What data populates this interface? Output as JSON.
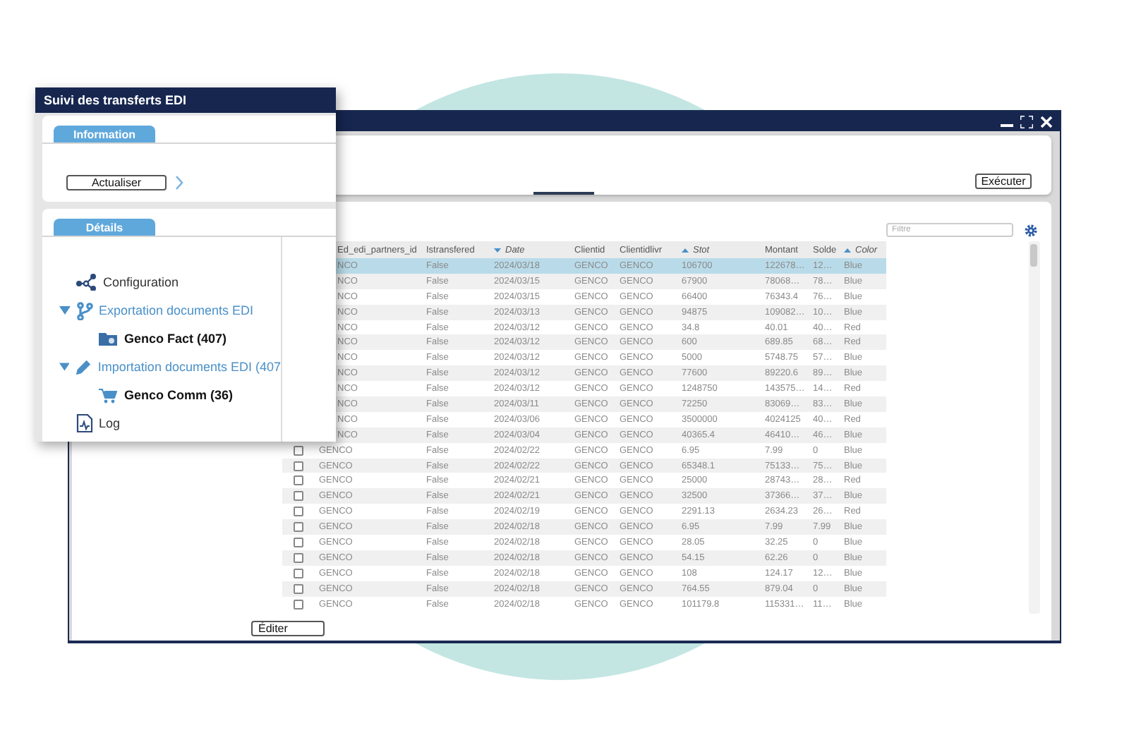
{
  "back_window": {
    "execute_button": "Exécuter",
    "filter": {
      "placeholder": "Filtre"
    },
    "table": {
      "columns": [
        {
          "label": "Ed_edi_partners_id"
        },
        {
          "label": "Istransfered"
        },
        {
          "label": "Date",
          "sort_ascending": false
        },
        {
          "label": "Clientid"
        },
        {
          "label": "Clientidlivr"
        },
        {
          "label": "Stot",
          "sort_ascending": true
        },
        {
          "label": "Montant"
        },
        {
          "label": "Solde"
        },
        {
          "label": "Color",
          "sort_ascending": true
        }
      ],
      "rows": [
        {
          "selected": true,
          "cells": [
            "NCO",
            "False",
            "2024/03/18",
            "GENCO",
            "GENCO",
            "106700",
            "122678…",
            "12…",
            "Blue"
          ]
        },
        {
          "selected": false,
          "cells": [
            "NCO",
            "False",
            "2024/03/15",
            "GENCO",
            "GENCO",
            "67900",
            "78068…",
            "78…",
            "Blue"
          ]
        },
        {
          "selected": false,
          "cells": [
            "NCO",
            "False",
            "2024/03/15",
            "GENCO",
            "GENCO",
            "66400",
            "76343.4",
            "76…",
            "Blue"
          ]
        },
        {
          "selected": false,
          "cells": [
            "NCO",
            "False",
            "2024/03/13",
            "GENCO",
            "GENCO",
            "94875",
            "109082…",
            "10…",
            "Blue"
          ]
        },
        {
          "selected": false,
          "cells": [
            "NCO",
            "False",
            "2024/03/12",
            "GENCO",
            "GENCO",
            "34.8",
            "40.01",
            "40…",
            "Red"
          ]
        },
        {
          "selected": false,
          "cells": [
            "NCO",
            "False",
            "2024/03/12",
            "GENCO",
            "GENCO",
            "600",
            "689.85",
            "68…",
            "Red"
          ]
        },
        {
          "selected": false,
          "cells": [
            "NCO",
            "False",
            "2024/03/12",
            "GENCO",
            "GENCO",
            "5000",
            "5748.75",
            "57…",
            "Blue"
          ]
        },
        {
          "selected": false,
          "cells": [
            "NCO",
            "False",
            "2024/03/12",
            "GENCO",
            "GENCO",
            "77600",
            "89220.6",
            "89…",
            "Blue"
          ]
        },
        {
          "selected": false,
          "cells": [
            "NCO",
            "False",
            "2024/03/12",
            "GENCO",
            "GENCO",
            "1248750",
            "143575…",
            "14…",
            "Red"
          ]
        },
        {
          "selected": false,
          "cells": [
            "NCO",
            "False",
            "2024/03/11",
            "GENCO",
            "GENCO",
            "72250",
            "83069…",
            "83…",
            "Blue"
          ]
        },
        {
          "selected": false,
          "cells": [
            "NCO",
            "False",
            "2024/03/06",
            "GENCO",
            "GENCO",
            "3500000",
            "4024125",
            "40…",
            "Red"
          ]
        },
        {
          "selected": false,
          "cells": [
            "NCO",
            "False",
            "2024/03/04",
            "GENCO",
            "GENCO",
            "40365.4",
            "46410…",
            "46…",
            "Blue"
          ]
        },
        {
          "selected": false,
          "checked": false,
          "cells": [
            "GENCO",
            "False",
            "2024/02/22",
            "GENCO",
            "GENCO",
            "6.95",
            "7.99",
            "0",
            "Blue"
          ]
        },
        {
          "selected": false,
          "checked": false,
          "cells": [
            "GENCO",
            "False",
            "2024/02/22",
            "GENCO",
            "GENCO",
            "65348.1",
            "75133…",
            "75…",
            "Blue"
          ]
        },
        {
          "selected": false,
          "checked": false,
          "cells": [
            "GENCO",
            "False",
            "2024/02/21",
            "GENCO",
            "GENCO",
            "25000",
            "28743…",
            "28…",
            "Red"
          ]
        },
        {
          "selected": false,
          "checked": false,
          "cells": [
            "GENCO",
            "False",
            "2024/02/21",
            "GENCO",
            "GENCO",
            "32500",
            "37366…",
            "37…",
            "Blue"
          ]
        },
        {
          "selected": false,
          "checked": false,
          "cells": [
            "GENCO",
            "False",
            "2024/02/19",
            "GENCO",
            "GENCO",
            "2291.13",
            "2634.23",
            "26…",
            "Red"
          ]
        },
        {
          "selected": false,
          "checked": false,
          "cells": [
            "GENCO",
            "False",
            "2024/02/18",
            "GENCO",
            "GENCO",
            "6.95",
            "7.99",
            "7.99",
            "Blue"
          ]
        },
        {
          "selected": false,
          "checked": false,
          "cells": [
            "GENCO",
            "False",
            "2024/02/18",
            "GENCO",
            "GENCO",
            "28.05",
            "32.25",
            "0",
            "Blue"
          ]
        },
        {
          "selected": false,
          "checked": false,
          "cells": [
            "GENCO",
            "False",
            "2024/02/18",
            "GENCO",
            "GENCO",
            "54.15",
            "62.26",
            "0",
            "Blue"
          ]
        },
        {
          "selected": false,
          "checked": false,
          "cells": [
            "GENCO",
            "False",
            "2024/02/18",
            "GENCO",
            "GENCO",
            "108",
            "124.17",
            "12…",
            "Blue"
          ]
        },
        {
          "selected": false,
          "checked": false,
          "cells": [
            "GENCO",
            "False",
            "2024/02/18",
            "GENCO",
            "GENCO",
            "764.55",
            "879.04",
            "0",
            "Blue"
          ]
        },
        {
          "selected": false,
          "checked": false,
          "cells": [
            "GENCO",
            "False",
            "2024/02/18",
            "GENCO",
            "GENCO",
            "101179.8",
            "115331…",
            "11…",
            "Blue"
          ]
        }
      ]
    },
    "edit_button": "Éditer"
  },
  "front_window": {
    "title": "Suivi des transferts EDI",
    "information": {
      "tab": {
        "label": "Information",
        "selected": true
      },
      "refresh_button": "Actualiser"
    },
    "details": {
      "tab": {
        "label": "Détails",
        "selected": true
      },
      "tree": [
        {
          "label": "Configuration"
        },
        {
          "label": "Exportation documents EDI",
          "expanded": true,
          "children": [
            {
              "label": "Genco Fact (407)"
            }
          ]
        },
        {
          "label": "Importation documents EDI (407",
          "expanded": true,
          "children": [
            {
              "label": "Genco Comm (36)"
            }
          ]
        },
        {
          "label": "Log"
        }
      ]
    }
  }
}
